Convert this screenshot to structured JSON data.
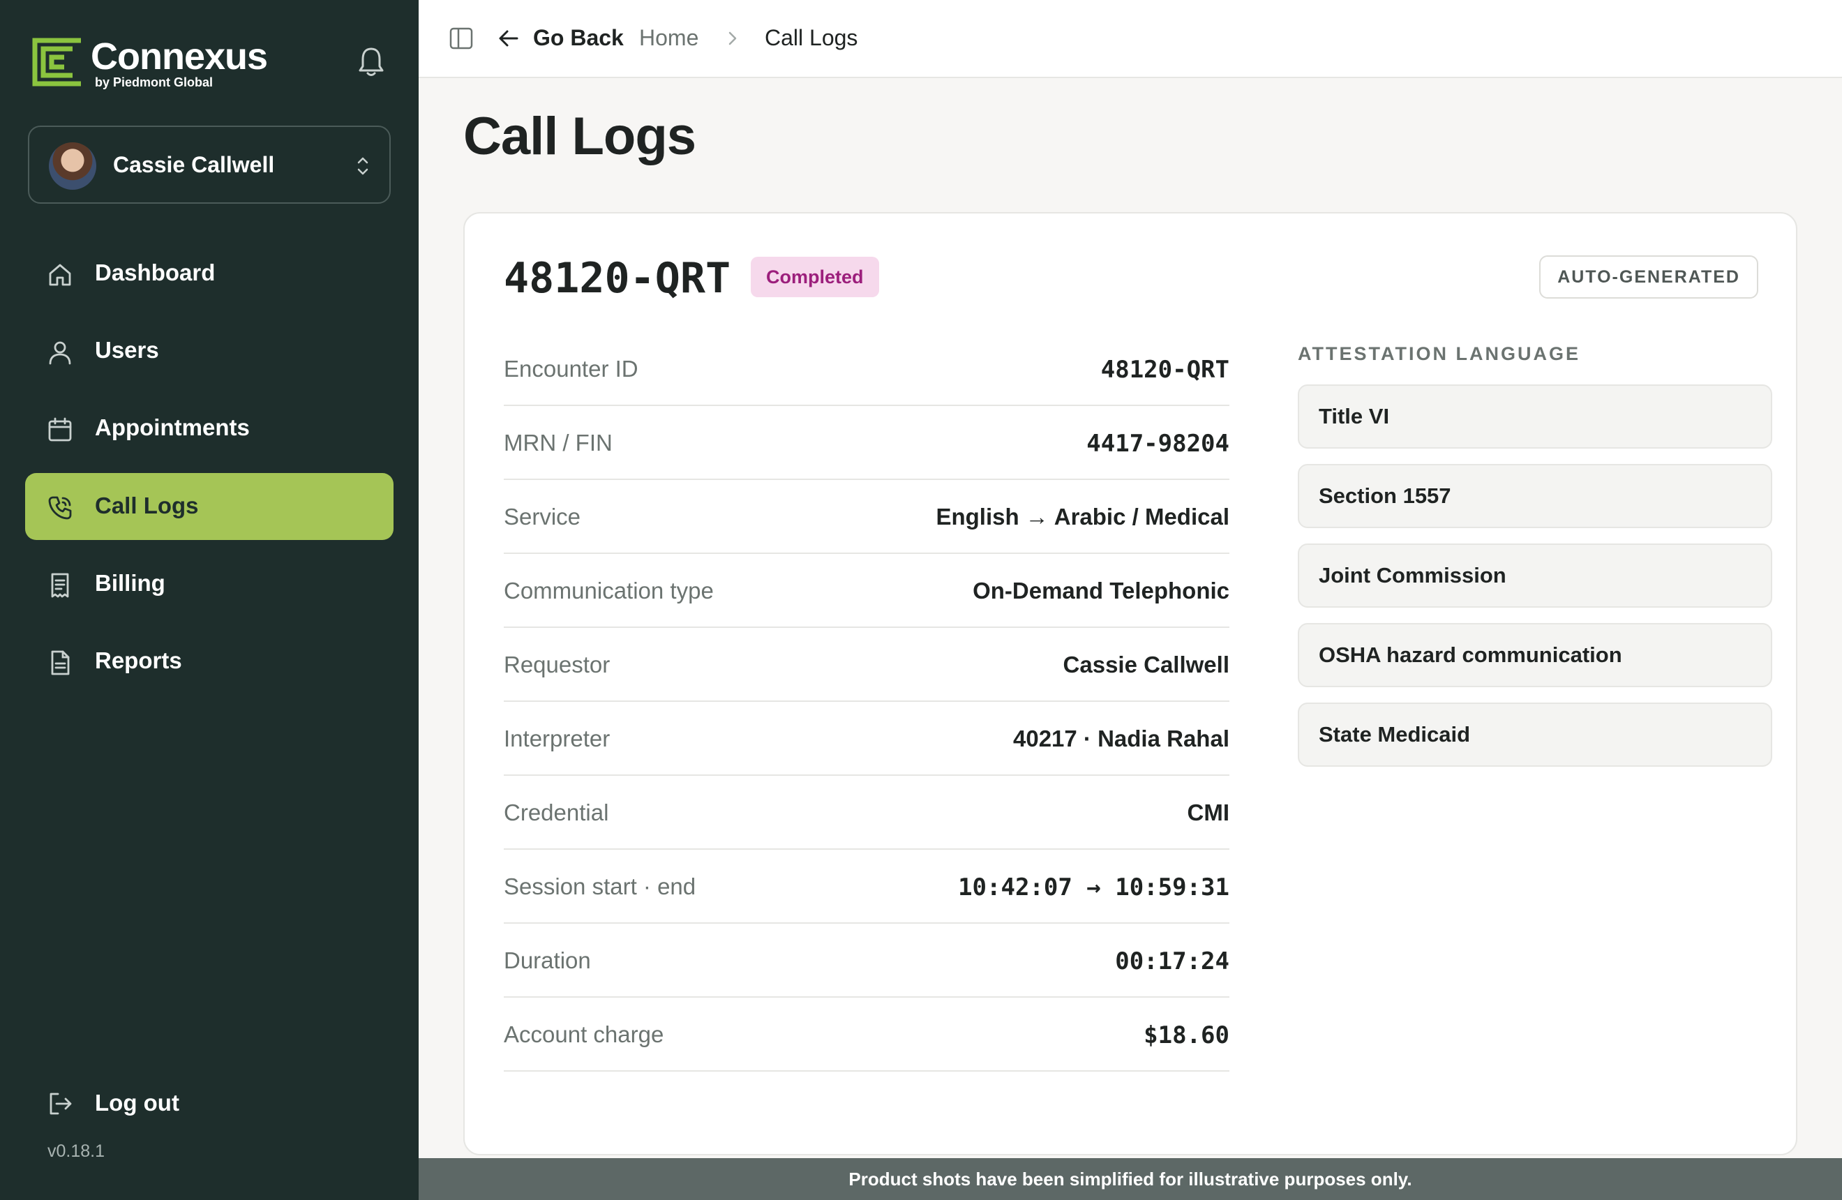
{
  "brand": {
    "name": "Connexus",
    "tagline": "by Piedmont Global",
    "accent": "#a5c556",
    "sidebar_bg": "#1e2e2c"
  },
  "user": {
    "name": "Cassie Callwell"
  },
  "nav": [
    {
      "label": "Dashboard",
      "icon": "home-icon"
    },
    {
      "label": "Users",
      "icon": "user-icon"
    },
    {
      "label": "Appointments",
      "icon": "calendar-icon"
    },
    {
      "label": "Call Logs",
      "icon": "phone-icon",
      "active": true
    },
    {
      "label": "Billing",
      "icon": "receipt-icon"
    },
    {
      "label": "Reports",
      "icon": "file-icon"
    }
  ],
  "logout": {
    "label": "Log out"
  },
  "version": "v0.18.1",
  "topbar": {
    "back_label": "Go Back",
    "breadcrumb": [
      "Home",
      "Call Logs"
    ]
  },
  "page": {
    "title": "Call Logs"
  },
  "encounter": {
    "id": "48120-QRT",
    "status": "Completed",
    "status_color": "#9c1f7c",
    "tag": "AUTO-GENERATED",
    "details": [
      {
        "key": "Encounter ID",
        "value": "48120-QRT",
        "mono": true
      },
      {
        "key": "MRN / FIN",
        "value": "4417-98204",
        "mono": true
      },
      {
        "key": "Service",
        "value": "English → Arabic / Medical"
      },
      {
        "key": "Communication type",
        "value": "On-Demand Telephonic"
      },
      {
        "key": "Requestor",
        "value": "Cassie Callwell"
      },
      {
        "key": "Interpreter",
        "value": "40217 · Nadia Rahal"
      },
      {
        "key": "Credential",
        "value": "CMI"
      },
      {
        "key": "Session start · end",
        "value": "10:42:07 → 10:59:31",
        "mono": true
      },
      {
        "key": "Duration",
        "value": "00:17:24",
        "mono": true
      },
      {
        "key": "Account charge",
        "value": "$18.60",
        "mono": true
      }
    ],
    "attestation": {
      "title": "ATTESTATION LANGUAGE",
      "items": [
        "Title VI",
        "Section 1557",
        "Joint Commission",
        "OSHA hazard communication",
        "State Medicaid"
      ]
    }
  },
  "disclaimer": "Product shots have been simplified for illustrative purposes only."
}
